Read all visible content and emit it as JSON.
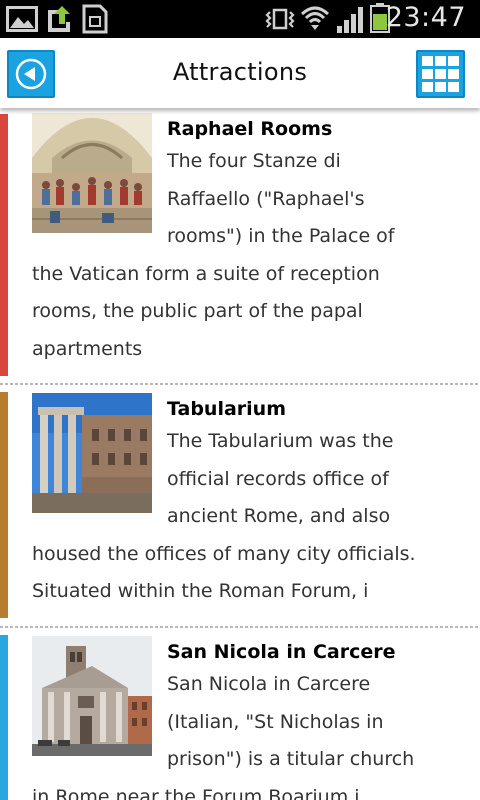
{
  "status_bar": {
    "time": "23:47",
    "icons": [
      "gallery-icon",
      "upload-icon",
      "sd-card-icon",
      "vibrate-icon",
      "wifi-icon",
      "signal-icon",
      "battery-icon"
    ],
    "battery_color": "#8dc63f"
  },
  "header": {
    "title": "Attractions",
    "back_icon": "back-arrow-icon",
    "grid_icon": "grid-icon",
    "button_color": "#1aa3e0"
  },
  "attractions": [
    {
      "title": "Raphael Rooms",
      "accent": "#d9463e",
      "thumbnail": "fresco-painting",
      "description_lines": [
        "The four Stanze di",
        "Raffaello (\"Raphael's",
        "rooms\") in the Palace of",
        "the Vatican form a suite of reception",
        "rooms, the public part of the papal",
        "apartments"
      ]
    },
    {
      "title": "Tabularium",
      "accent": "#b87c2e",
      "thumbnail": "ruins-photo",
      "description_lines": [
        "The Tabularium was the",
        "official records office of",
        "ancient Rome, and also",
        "housed the offices of many city officials.",
        "Situated within the Roman Forum, i"
      ]
    },
    {
      "title": "San Nicola in Carcere",
      "accent": "#29a7df",
      "thumbnail": "church-photo",
      "description_lines": [
        "San Nicola in Carcere",
        "(Italian, \"St Nicholas in",
        "prison\") is a titular church",
        "in Rome near the Forum Boarium i"
      ]
    }
  ]
}
